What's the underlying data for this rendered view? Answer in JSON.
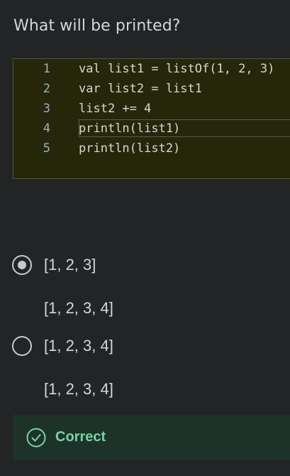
{
  "question": "What will be printed?",
  "code": {
    "lines": [
      {
        "num": "1",
        "text": "val list1 = listOf(1, 2, 3)"
      },
      {
        "num": "2",
        "text": "var list2 = list1"
      },
      {
        "num": "3",
        "text": "list2 += 4"
      },
      {
        "num": "4",
        "text": "println(list1)"
      },
      {
        "num": "5",
        "text": "println(list2)"
      }
    ]
  },
  "options": [
    {
      "line1": "[1, 2, 3]",
      "line2": "[1, 2, 3, 4]",
      "selected": true
    },
    {
      "line1": "[1, 2, 3, 4]",
      "line2": "[1, 2, 3, 4]",
      "selected": false
    }
  ],
  "feedback": {
    "label": "Correct",
    "icon": "check-circle-icon",
    "color": "#74d4a6"
  }
}
